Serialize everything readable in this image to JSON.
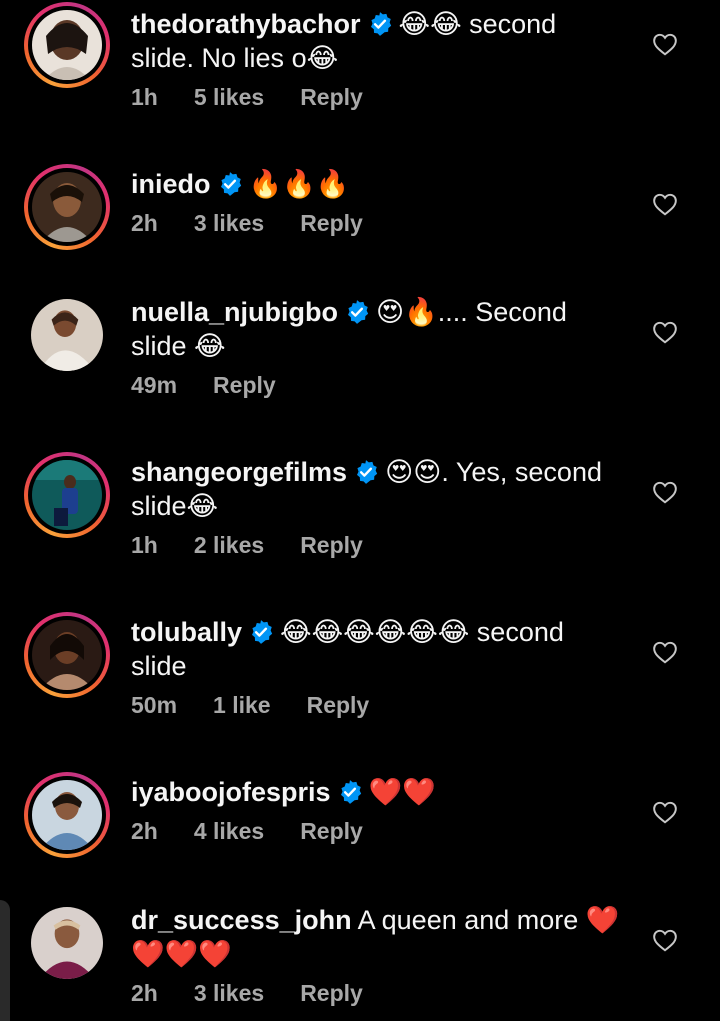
{
  "comments": [
    {
      "username": "thedorathybachor",
      "verified": true,
      "text_line1": "😂😂 second",
      "text_line2": "slide. No lies o😂",
      "time": "1h",
      "likes": "5 likes",
      "reply": "Reply",
      "has_story_ring": true
    },
    {
      "username": "iniedo",
      "verified": true,
      "text_line1": "🔥🔥🔥",
      "text_line2": "",
      "time": "2h",
      "likes": "3 likes",
      "reply": "Reply",
      "has_story_ring": true
    },
    {
      "username": "nuella_njubigbo",
      "verified": true,
      "text_line1": "😍🔥.... Second",
      "text_line2": "slide 😂",
      "time": "49m",
      "likes": "",
      "reply": "Reply",
      "has_story_ring": false
    },
    {
      "username": "shangeorgefilms",
      "verified": true,
      "text_line1": "😍😍. Yes, second",
      "text_line2": "slide😂",
      "time": "1h",
      "likes": "2 likes",
      "reply": "Reply",
      "has_story_ring": true
    },
    {
      "username": "tolubally",
      "verified": true,
      "text_line1": "😂😂😂😂😂😂 second",
      "text_line2": "slide",
      "time": "50m",
      "likes": "1 like",
      "reply": "Reply",
      "has_story_ring": true
    },
    {
      "username": "iyaboojofespris",
      "verified": true,
      "text_line1": "❤️❤️",
      "text_line2": "",
      "time": "2h",
      "likes": "4 likes",
      "reply": "Reply",
      "has_story_ring": true
    },
    {
      "username": "dr_success_john",
      "verified": false,
      "text_line1": "A queen and more ❤️",
      "text_line2": "❤️❤️❤️",
      "time": "2h",
      "likes": "3 likes",
      "reply": "Reply",
      "has_story_ring": false
    }
  ],
  "icons": {
    "verified": "verified-badge-icon",
    "like": "heart-outline-icon"
  },
  "colors": {
    "background": "#000000",
    "text": "#f5f5f5",
    "meta": "#a8a8a8",
    "verified_blue": "#0095f6",
    "heart_outline": "#c7c7c7"
  }
}
